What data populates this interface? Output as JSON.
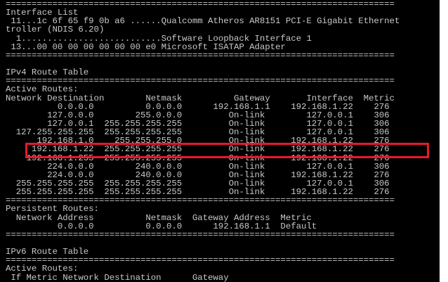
{
  "console": {
    "lines": [
      "===========================================================================",
      "Interface List",
      " 11...1c 6f 65 f9 0b a6 ......Qualcomm Atheros AR8151 PCI-E Gigabit Ethernet",
      "troller (NDIS 6.20)",
      "  1...........................Software Loopback Interface 1",
      " 13...00 00 00 00 00 00 00 e0 Microsoft ISATAP Adapter",
      "===========================================================================",
      "",
      "IPv4 Route Table",
      "===========================================================================",
      "Active Routes:",
      "Network Destination        Netmask          Gateway       Interface  Metric",
      "          0.0.0.0          0.0.0.0      192.168.1.1    192.168.1.22    276",
      "        127.0.0.0        255.0.0.0         On-link        127.0.0.1    306",
      "        127.0.0.1  255.255.255.255         On-link        127.0.0.1    306",
      "  127.255.255.255  255.255.255.255         On-link        127.0.0.1    306",
      "      192.168.1.0    255.255.255.0         On-link     192.168.1.22    276",
      "     192.168.1.22  255.255.255.255         On-link     192.168.1.22    276",
      "    192.168.1.255  255.255.255.255         On-link     192.168.1.22    276",
      "        224.0.0.0        240.0.0.0         On-link        127.0.0.1    306",
      "        224.0.0.0        240.0.0.0         On-link     192.168.1.22    276",
      "  255.255.255.255  255.255.255.255         On-link        127.0.0.1    306",
      "  255.255.255.255  255.255.255.255         On-link     192.168.1.22    276",
      "===========================================================================",
      "Persistent Routes:",
      "  Network Address          Netmask  Gateway Address  Metric",
      "          0.0.0.0          0.0.0.0      192.168.1.1  Default",
      "===========================================================================",
      "",
      "IPv6 Route Table",
      "===========================================================================",
      "Active Routes:",
      " If Metric Network Destination      Gateway"
    ]
  },
  "highlight": {
    "color": "#e8192c",
    "line_index": 17
  }
}
